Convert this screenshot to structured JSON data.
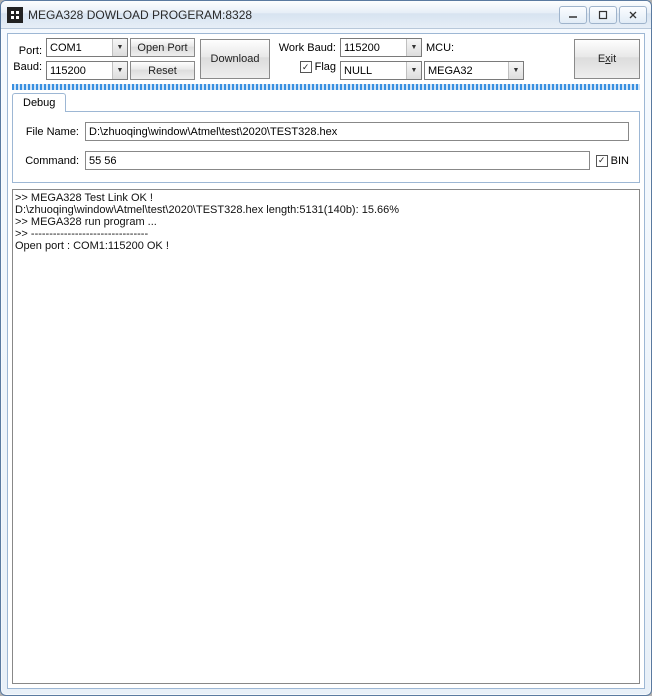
{
  "window": {
    "title": "MEGA328 DOWLOAD PROGERAM:8328"
  },
  "toolbar": {
    "port_label": "Port:",
    "port_value": "COM1",
    "baud_label": "Baud:",
    "baud_value": "115200",
    "open_port": "Open Port",
    "reset": "Reset",
    "download": "Download",
    "work_baud_label": "Work Baud:",
    "work_baud_value": "115200",
    "flag_label": "Flag",
    "flag_checked": true,
    "null_value": "NULL",
    "mcu_label": "MCU:",
    "mcu_value": "MEGA32",
    "exit_prefix": "E",
    "exit_key": "x",
    "exit_suffix": "it"
  },
  "tabs": {
    "debug": "Debug"
  },
  "fields": {
    "filename_label": "File Name:",
    "filename_value": "D:\\zhuoqing\\window\\Atmel\\test\\2020\\TEST328.hex",
    "command_label": "Command:",
    "command_value": "55 56",
    "bin_label": "BIN",
    "bin_checked": true
  },
  "console": {
    "lines": [
      ">> MEGA328 Test Link OK !",
      "D:\\zhuoqing\\window\\Atmel\\test\\2020\\TEST328.hex length:5131(140b): 15.66%",
      ">> MEGA328 run program ...",
      ">> --------------------------------",
      "Open port : COM1:115200 OK !"
    ]
  }
}
